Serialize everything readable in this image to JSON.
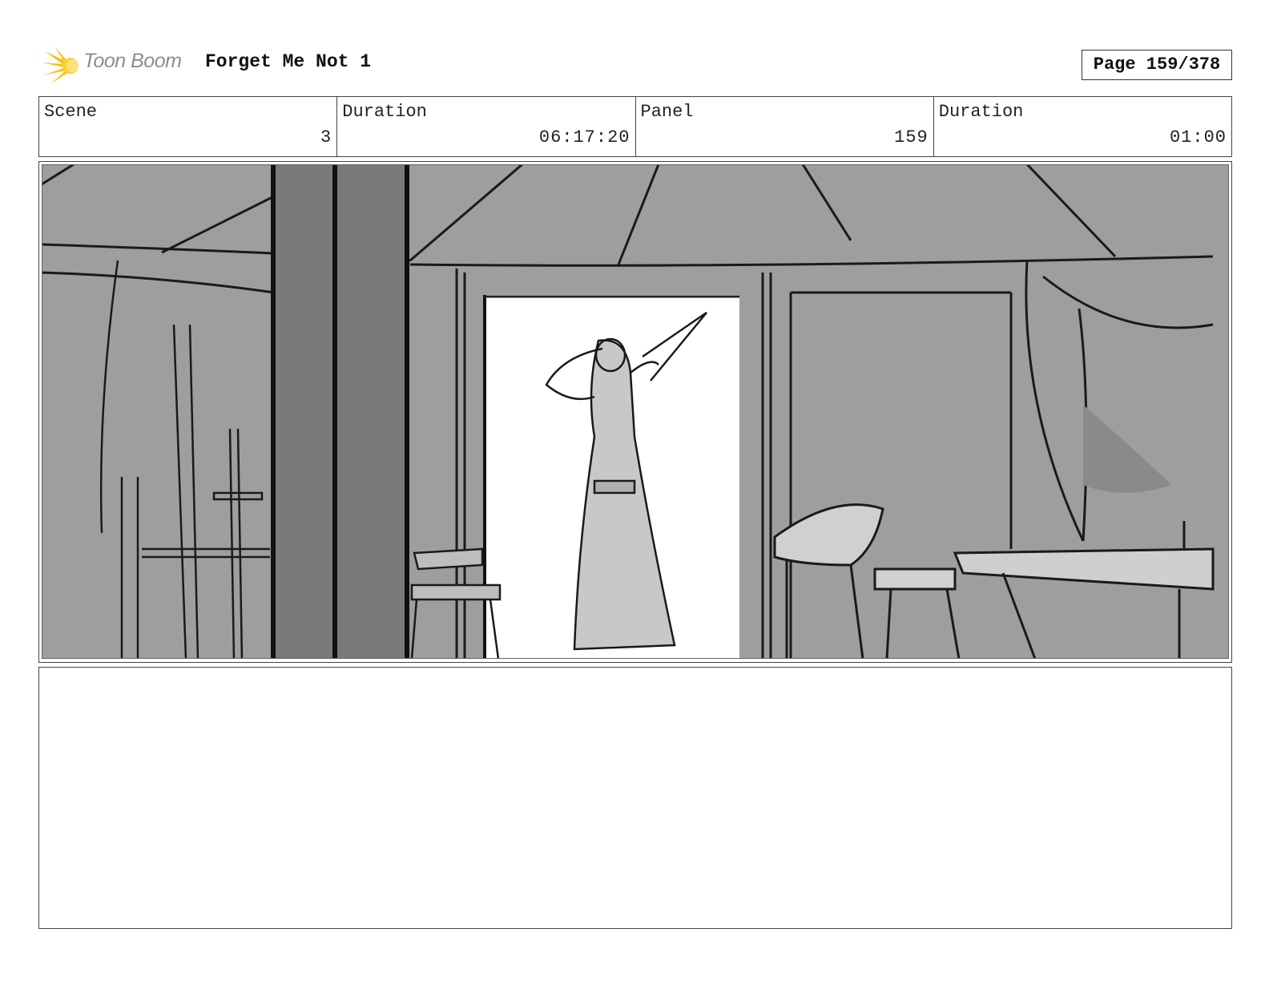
{
  "header": {
    "logo_text": "Toon Boom",
    "project_title": "Forget Me Not 1",
    "page_indicator": "Page 159/378"
  },
  "info": {
    "scene_label": "Scene",
    "scene_value": "3",
    "scene_duration_label": "Duration",
    "scene_duration_value": "06:17:20",
    "panel_label": "Panel",
    "panel_value": "159",
    "panel_duration_label": "Duration",
    "panel_duration_value": "01:00"
  },
  "panel": {
    "image_subject": "storyboard-sketch-tent-interior-figure-in-doorway"
  },
  "colors": {
    "logo_accent": "#f5c518",
    "sketch_background": "#9e9e9e",
    "doorway_light": "#ffffff"
  }
}
